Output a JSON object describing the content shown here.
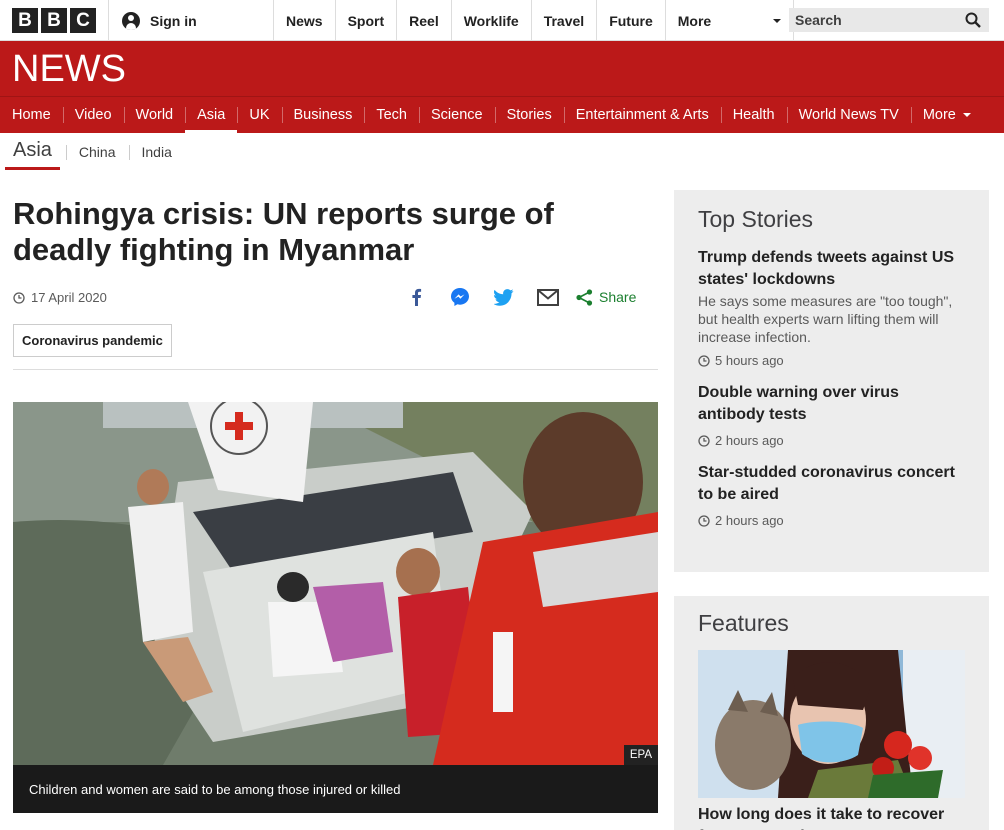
{
  "topbar": {
    "logo_letters": [
      "B",
      "B",
      "C"
    ],
    "signin_label": "Sign in",
    "nav": [
      "News",
      "Sport",
      "Reel",
      "Worklife",
      "Travel",
      "Future"
    ],
    "more_label": "More",
    "search_placeholder": "Search"
  },
  "header": {
    "logo": "NEWS",
    "nav": [
      "Home",
      "Video",
      "World",
      "Asia",
      "UK",
      "Business",
      "Tech",
      "Science",
      "Stories",
      "Entertainment & Arts",
      "Health",
      "World News TV"
    ],
    "active_nav": "Asia",
    "more_label": "More"
  },
  "subnav": {
    "section": "Asia",
    "items": [
      "China",
      "India"
    ]
  },
  "article": {
    "headline": "Rohingya crisis: UN reports surge of deadly fighting in Myanmar",
    "date": "17 April 2020",
    "share_label": "Share",
    "tag": "Coronavirus pandemic",
    "photo_credit": "EPA",
    "caption": "Children and women are said to be among those injured or killed"
  },
  "top_stories": {
    "title": "Top Stories",
    "items": [
      {
        "title": "Trump defends tweets against US states' lockdowns",
        "summary": "He says some measures are \"too tough\", but health experts warn lifting them will increase infection.",
        "time": "5 hours ago"
      },
      {
        "title": "Double warning over virus antibody tests",
        "summary": "",
        "time": "2 hours ago"
      },
      {
        "title": "Star-studded coronavirus concert to be aired",
        "summary": "",
        "time": "2 hours ago"
      }
    ]
  },
  "features": {
    "title": "Features",
    "item_title": "How long does it take to recover from coronavirus?"
  },
  "colors": {
    "brand_red": "#bb1919",
    "share_green": "#1b7f2f",
    "facebook_blue": "#3b5998",
    "twitter_blue": "#1da1f2"
  }
}
